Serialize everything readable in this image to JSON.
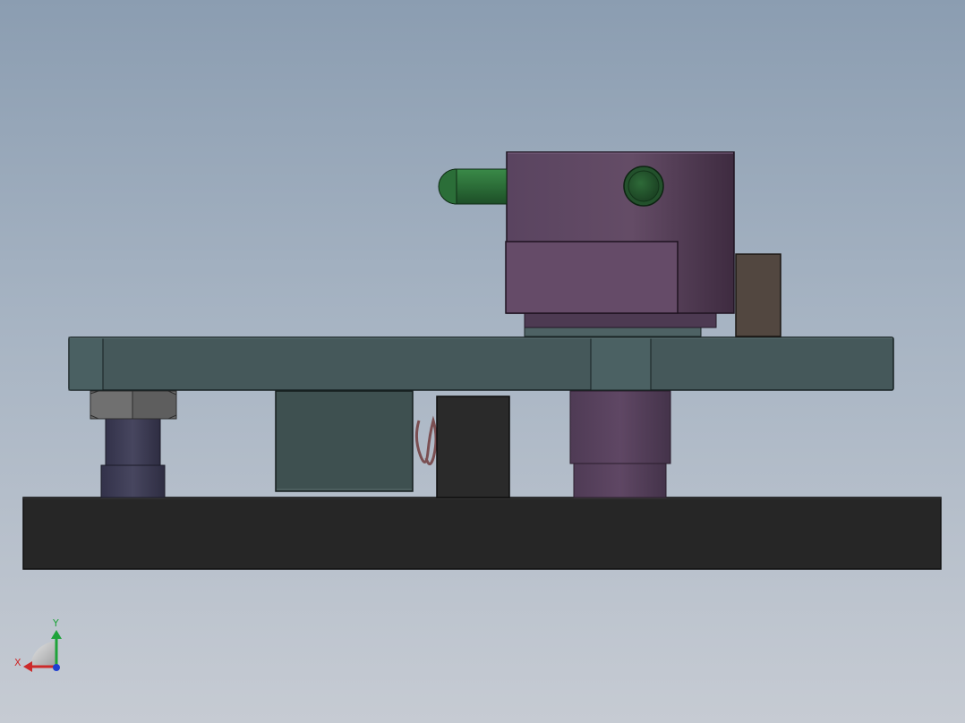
{
  "viewport": {
    "background_top": "#8b9db1",
    "background_bottom": "#c6cbd3"
  },
  "triad": {
    "x_label": "X",
    "y_label": "Y",
    "x_color": "#cc2a2a",
    "y_color": "#1ea33a",
    "z_color": "#1f3fd0"
  },
  "model": {
    "base_plate_color": "#262626",
    "fixture_plate_color": "#45585a",
    "clamp_body_color": "#5e4661",
    "handle_color": "#2f6e3a",
    "stopper_block_color": "#524740",
    "nut_color": "#666666",
    "post_color": "#3e3c55",
    "spring_color": "#7a4f52"
  }
}
